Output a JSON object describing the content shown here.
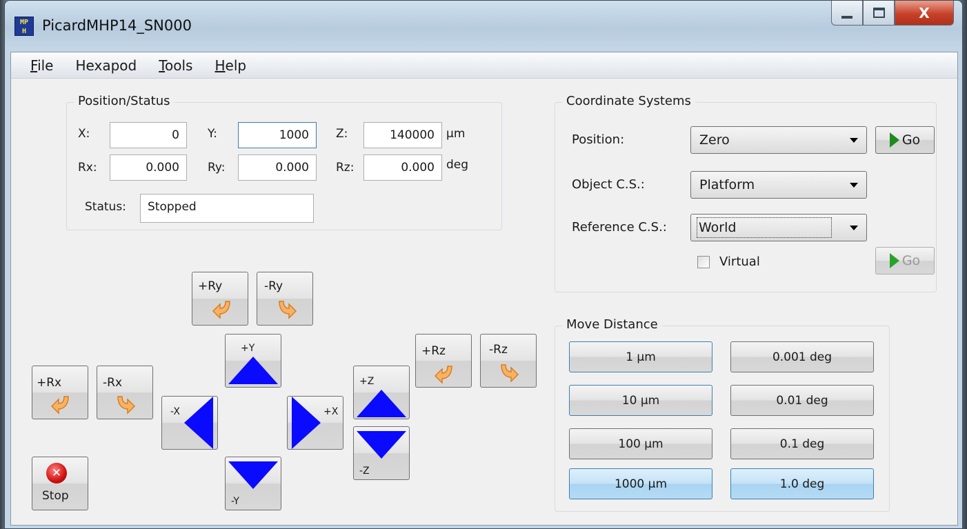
{
  "window": {
    "title": "PicardMHP14_SN000",
    "icon_text": "MP\nH",
    "controls": {
      "minimize": "minimize-icon",
      "maximize": "maximize-icon",
      "close_label": "X"
    }
  },
  "menu": {
    "items": [
      {
        "label": "File",
        "mnemonic": "F",
        "rest": "ile"
      },
      {
        "label": "Hexapod",
        "mnemonic": "",
        "rest": "Hexapod"
      },
      {
        "label": "Tools",
        "mnemonic": "T",
        "rest": "ools"
      },
      {
        "label": "Help",
        "mnemonic": "H",
        "rest": "elp"
      }
    ]
  },
  "position_status": {
    "legend": "Position/Status",
    "x_label": "X:",
    "x_value": "0",
    "y_label": "Y:",
    "y_value": "1000",
    "z_label": "Z:",
    "z_value": "140000",
    "pos_unit": "µm",
    "rx_label": "Rx:",
    "rx_value": "0.000",
    "ry_label": "Ry:",
    "ry_value": "0.000",
    "rz_label": "Rz:",
    "rz_value": "0.000",
    "rot_unit": "deg",
    "status_label": "Status:",
    "status_value": "Stopped"
  },
  "coordinate_systems": {
    "legend": "Coordinate Systems",
    "position_label": "Position:",
    "position_value": "Zero",
    "object_label": "Object C.S.:",
    "object_value": "Platform",
    "reference_label": "Reference C.S.:",
    "reference_value": "World",
    "go_label": "Go",
    "virtual_label": "Virtual",
    "virtual_checked": false,
    "go2_label": "Go"
  },
  "jog": {
    "plus_ry": "+Ry",
    "minus_ry": "-Ry",
    "plus_rx": "+Rx",
    "minus_rx": "-Rx",
    "plus_rz": "+Rz",
    "minus_rz": "-Rz",
    "plus_y": "+Y",
    "minus_y": "-Y",
    "minus_x": "-X",
    "plus_x": "+X",
    "plus_z": "+Z",
    "minus_z": "-Z",
    "stop": "Stop",
    "arrow_color": "#0a0aff",
    "rotate_icon_color": "#f5a54a"
  },
  "move_distance": {
    "legend": "Move Distance",
    "linear": [
      {
        "label": "1 µm",
        "selected": false
      },
      {
        "label": "10 µm",
        "selected": false
      },
      {
        "label": "100 µm",
        "selected": false
      },
      {
        "label": "1000 µm",
        "selected": true
      }
    ],
    "angular": [
      {
        "label": "0.001 deg",
        "selected": false
      },
      {
        "label": "0.01 deg",
        "selected": false
      },
      {
        "label": "0.1 deg",
        "selected": false
      },
      {
        "label": "1.0 deg",
        "selected": true
      }
    ]
  }
}
